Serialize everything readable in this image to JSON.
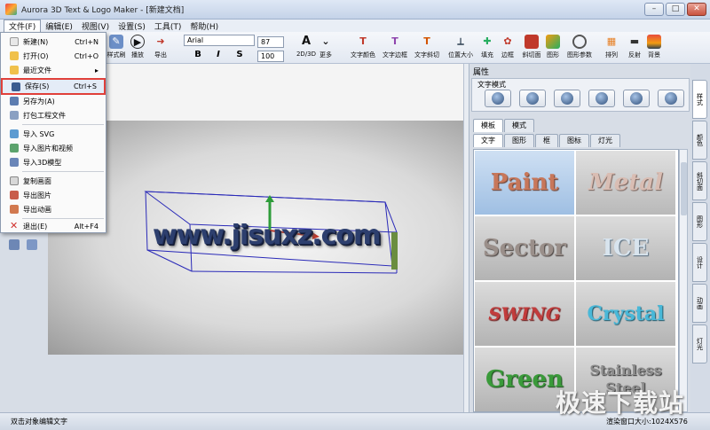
{
  "window": {
    "title": "Aurora 3D Text & Logo Maker - [新建文档]",
    "min": "–",
    "max": "□",
    "close": "✕"
  },
  "menu": [
    "文件(F)",
    "编辑(E)",
    "视图(V)",
    "设置(S)",
    "工具(T)",
    "帮助(H)"
  ],
  "toolbar": {
    "left_tools": [
      "样式刷",
      "播放",
      "导出"
    ],
    "font_name": "Arial",
    "font_size": "87",
    "line_size": "100",
    "bold": "B",
    "italic": "I",
    "strike": "S",
    "mode_2d3d": "2D/3D",
    "more": "更多",
    "tools": [
      "文字颜色",
      "文字边框",
      "文字斜切",
      "位置大小",
      "填充",
      "边框",
      "斜切面",
      "图形",
      "图形参数",
      "排列",
      "反射",
      "背景"
    ]
  },
  "file_menu": {
    "items": [
      {
        "label": "新建(N)",
        "shortcut": "Ctrl+N"
      },
      {
        "label": "打开(O)",
        "shortcut": "Ctrl+O"
      },
      {
        "label": "最近文件",
        "shortcut": "▸"
      },
      {
        "label": "保存(S)",
        "shortcut": "Ctrl+S"
      },
      {
        "label": "另存为(A)",
        "shortcut": ""
      },
      {
        "label": "打包工程文件",
        "shortcut": ""
      },
      {
        "label": "导入 SVG",
        "shortcut": ""
      },
      {
        "label": "导入图片和视频",
        "shortcut": ""
      },
      {
        "label": "导入3D模型",
        "shortcut": ""
      },
      {
        "label": "复制画面",
        "shortcut": ""
      },
      {
        "label": "导出图片",
        "shortcut": ""
      },
      {
        "label": "导出动画",
        "shortcut": ""
      },
      {
        "label": "退出(E)",
        "shortcut": "Alt+F4"
      }
    ]
  },
  "canvas": {
    "text": "www.jisuxz.com"
  },
  "panel": {
    "title": "属性",
    "section": "文字模式",
    "tabs_top": [
      "模板",
      "模式"
    ],
    "tabs_sub": [
      "文字",
      "图形",
      "框",
      "图标",
      "灯光"
    ],
    "styles": [
      {
        "label": "Paint",
        "color": "#c8775a"
      },
      {
        "label": "Metal",
        "color": "#c9aaa0"
      },
      {
        "label": "Sector",
        "color": "#9a8f8a"
      },
      {
        "label": "ICE",
        "color": "#b9cbd9"
      },
      {
        "label": "SWING",
        "color": "#c23c3c"
      },
      {
        "label": "Crystal",
        "color": "#49b8d8"
      },
      {
        "label": "Green",
        "color": "#3a9a3a"
      },
      {
        "label": "Stainless Steel",
        "color": "#8c8c8c"
      }
    ]
  },
  "side_tabs": [
    "样式",
    "颜色",
    "斜切面",
    "图形",
    "设计",
    "动画",
    "灯光"
  ],
  "status": {
    "left": "双击对象编辑文字",
    "right": "渲染窗口大小:1024X576"
  },
  "watermark": "极速下载站"
}
